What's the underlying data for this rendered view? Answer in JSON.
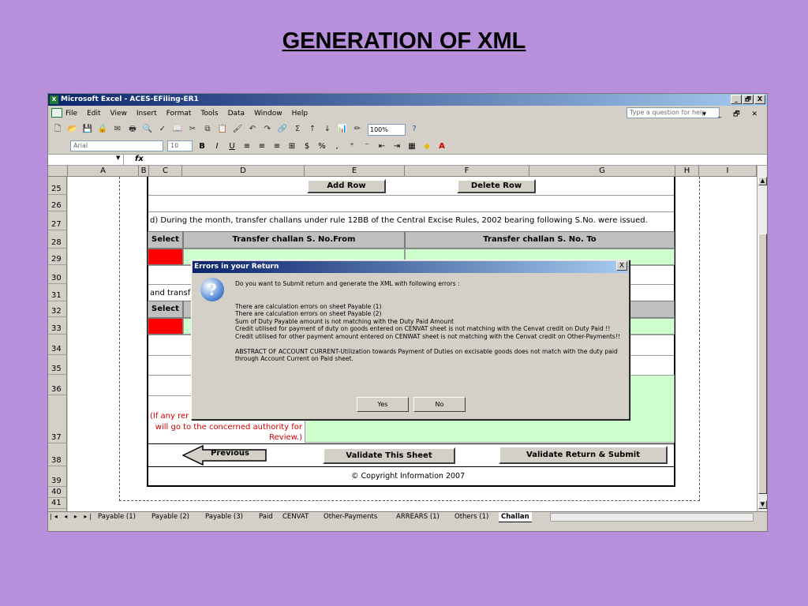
{
  "slide": {
    "title": "GENERATION OF XML"
  },
  "window": {
    "title": "Microsoft Excel - ACES-EFiling-ER1",
    "min": "_",
    "restore": "🗗",
    "close": "X"
  },
  "menu": {
    "items": [
      "File",
      "Edit",
      "View",
      "Insert",
      "Format",
      "Tools",
      "Data",
      "Window",
      "Help"
    ],
    "ask_placeholder": "Type a question for help"
  },
  "toolbar": {
    "zoom": "100%",
    "font": "Arial",
    "size": "10",
    "bold": "B",
    "italic": "I",
    "underline": "U",
    "currency": "$",
    "percent": "%"
  },
  "formula": {
    "fx": "fx"
  },
  "columns": [
    "A",
    "B",
    "C",
    "D",
    "E",
    "F",
    "G",
    "H",
    "I"
  ],
  "rows": [
    "25",
    "26",
    "27",
    "28",
    "29",
    "30",
    "31",
    "32",
    "33",
    "34",
    "35",
    "36",
    "37",
    "38",
    "39",
    "40",
    "41"
  ],
  "form": {
    "add_row": "Add Row",
    "delete_row": "Delete Row",
    "section_d": "d) During the month, transfer challans under rule 12BB of the Central Excise Rules, 2002 bearing following S.No. were issued.",
    "select1": "Select",
    "from_head": "Transfer challan S. No.From",
    "to_head": "Transfer challan S. No. To",
    "and_transf": "and transf",
    "select2": "Select",
    "note_line1": "(If any rer",
    "note_line2": "will go to the concerned authority for",
    "note_line3": "Review.)",
    "previous": "Previous",
    "validate_sheet": "Validate This Sheet",
    "validate_submit": "Validate Return & Submit",
    "copyright": "© Copyright Information 2007"
  },
  "tabs": {
    "items": [
      "Payable (1)",
      "Payable (2)",
      "Payable (3)",
      "Paid",
      "CENVAT",
      "Other-Payments",
      "ARREARS (1)",
      "Others (1)",
      "Challan"
    ],
    "active": "Challan"
  },
  "dialog": {
    "title": "Errors in your Return",
    "close": "X",
    "icon": "?",
    "intro": "Do you want to Submit return and generate the XML with following errors :",
    "errors": [
      "There are calculation errors on sheet Payable (1)",
      "There are calculation errors on sheet Payable (2)",
      "Sum of Duty Payable amount is not matching with the Duty Paid Amount",
      "Credit utilised for payment of duty on goods entered on CENVAT sheet is not matching with the Cenvat credit on Duty Paid !!",
      "Credit utilised for other payment amount entered on CENWAT sheet is not matching with the Cenvat credit on Other-Payments!!"
    ],
    "abstract": "ABSTRACT OF ACCOUNT CURRENT-Utilization towards Payment of Duties on excisable goods does not match with the duty paid through Account Current on Paid sheet.",
    "yes": "Yes",
    "no": "No"
  }
}
